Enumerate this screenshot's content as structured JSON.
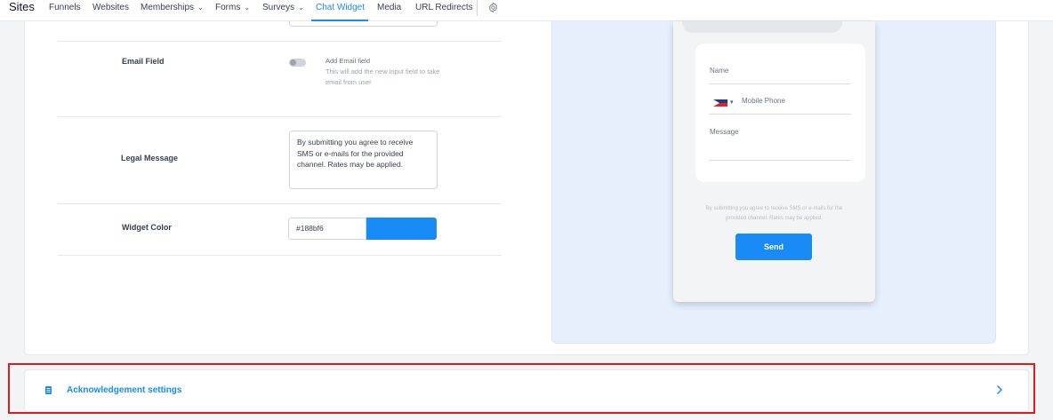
{
  "nav": {
    "title": "Sites",
    "items": [
      {
        "label": "Funnels"
      },
      {
        "label": "Websites"
      },
      {
        "label": "Memberships"
      },
      {
        "label": "Forms"
      },
      {
        "label": "Surveys"
      },
      {
        "label": "Chat Widget"
      },
      {
        "label": "Media"
      },
      {
        "label": "URL Redirects"
      }
    ],
    "active": "Chat Widget",
    "settings_icon": "gear-icon"
  },
  "settings": {
    "email_field": {
      "label": "Email Field",
      "toggle_title": "Add Email field",
      "toggle_description": "This will add the new input field to take email from user",
      "enabled": false
    },
    "legal_message": {
      "label": "Legal Message",
      "value": "By submitting you agree to receive SMS or e-mails for the provided channel. Rates may be applied."
    },
    "widget_color": {
      "label": "Widget Color",
      "value": "#188bf6"
    }
  },
  "preview": {
    "name_placeholder": "Name",
    "phone_placeholder": "Mobile Phone",
    "message_placeholder": "Message",
    "legal_text": "By submitting you agree to receive SMS or e-mails for the provided channel. Rates may be applied.",
    "send_label": "Send"
  },
  "acknowledgement": {
    "title": "Acknowledgement settings"
  },
  "colors": {
    "accent": "#188bf6",
    "highlight": "#e01b1b"
  }
}
